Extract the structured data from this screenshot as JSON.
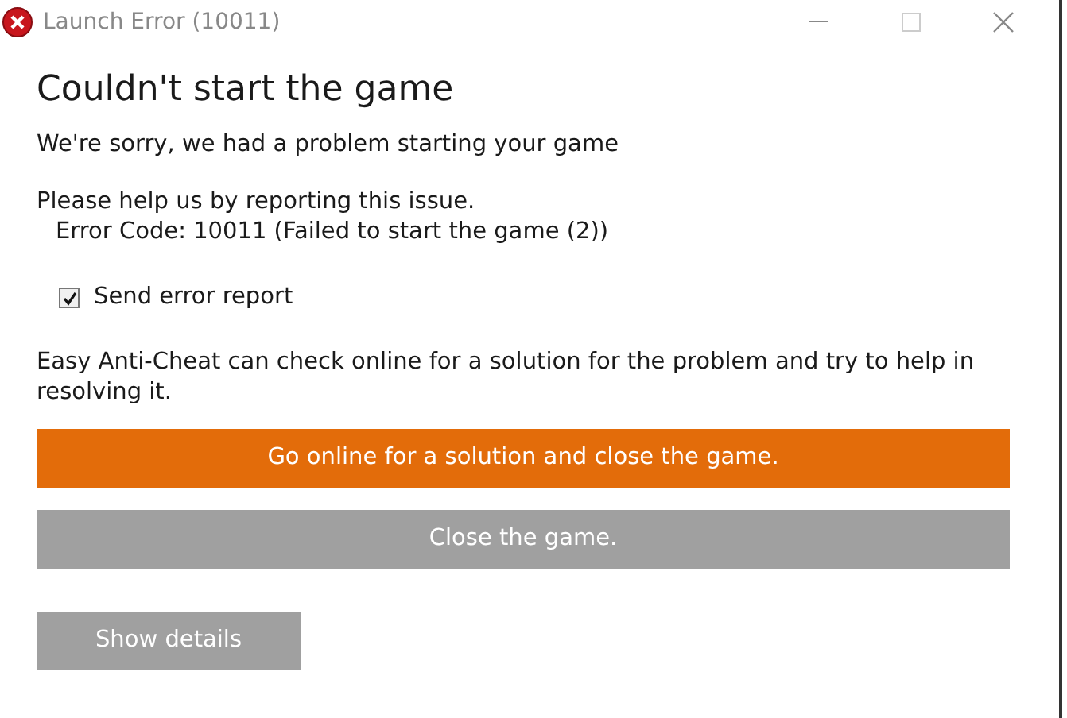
{
  "window": {
    "title": "Launch Error (10011)"
  },
  "heading": "Couldn't start the game",
  "subtitle": "We're sorry, we had a problem starting your game",
  "report_request": "Please help us by reporting this issue.",
  "error_code": "Error Code: 10011 (Failed to start the game (2))",
  "send_report": {
    "label": "Send error report",
    "checked": true
  },
  "info": "Easy Anti-Cheat can check online for a solution for the problem and try to help in resolving it.",
  "actions": [
    {
      "label": "Go online for a solution and close the game.",
      "kind": "primary"
    },
    {
      "label": "Close the game.",
      "kind": "secondary"
    }
  ],
  "details_button": {
    "label": "Show details"
  }
}
